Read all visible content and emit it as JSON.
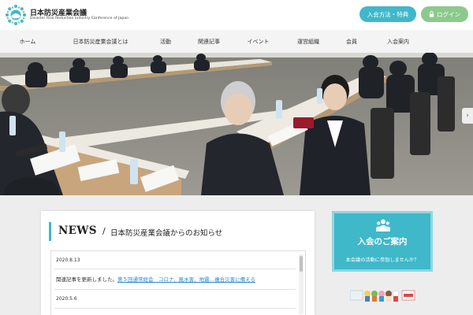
{
  "brand": {
    "name_jp": "日本防災産業会議",
    "name_en": "Disaster Risk Reduction Industry Conference of Japan"
  },
  "header_buttons": {
    "join": "入会方法・特典",
    "login": "ログイン"
  },
  "nav": [
    "ホーム",
    "日本防災産業会議とは",
    "活動",
    "関連記事",
    "イベント",
    "運営組織",
    "会員",
    "入会案内"
  ],
  "news": {
    "heading": "NEWS",
    "slash": "/",
    "subheading": "日本防災産業会議からのお知らせ",
    "items": [
      {
        "date": "2020.8.13",
        "text": "関連記事を更新しました。",
        "link": "第５回通常総会　コロナ、風水害、地震…複合災害に備える"
      },
      {
        "date": "2020.5.6"
      }
    ]
  },
  "banner": {
    "title": "入会のご案内",
    "subtitle": "本会議の活動に参加しませんか？"
  },
  "colors": {
    "accent": "#3fb8c9",
    "login": "#8cc98c",
    "link": "#2a86c8"
  },
  "icons": [
    "logo-icon",
    "lock-icon",
    "chevron-right-icon",
    "people-icon",
    "mascot-icons"
  ]
}
